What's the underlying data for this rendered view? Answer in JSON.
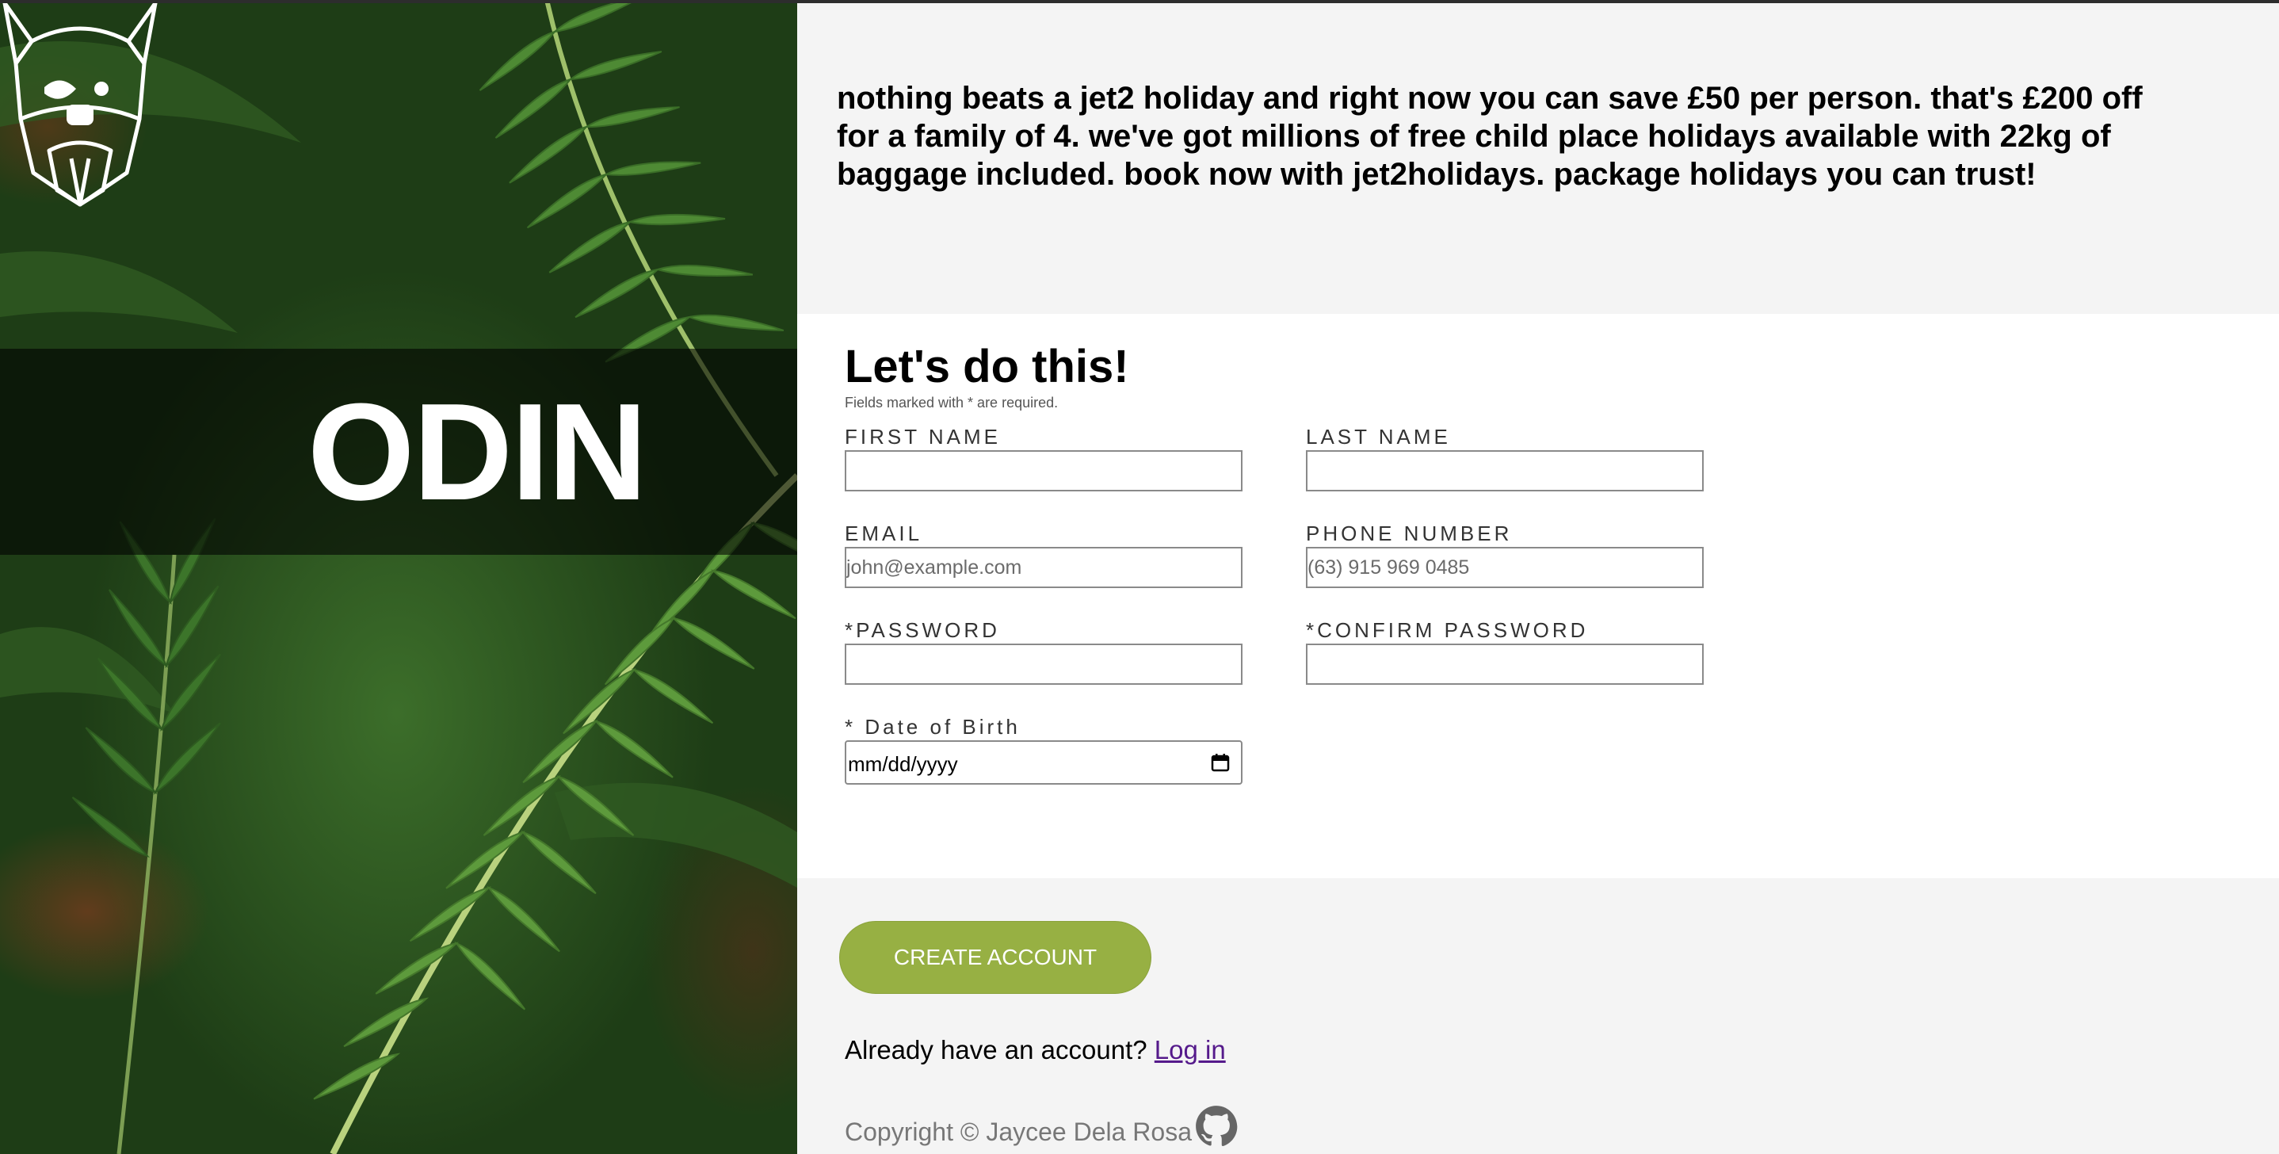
{
  "brand": {
    "logo_text": "ODIN"
  },
  "promo": {
    "text": "nothing beats a jet2 holiday and right now you can save £50 per person. that's £200 off for a family of 4. we've got millions of free child place holidays available with 22kg of baggage included. book now with jet2holidays. package holidays you can trust!"
  },
  "form": {
    "title": "Let's do this!",
    "note": "Fields marked with * are required.",
    "first_name": {
      "label": "FIRST NAME",
      "value": "",
      "placeholder": ""
    },
    "last_name": {
      "label": "LAST NAME",
      "value": "",
      "placeholder": ""
    },
    "email": {
      "label": "EMAIL",
      "value": "",
      "placeholder": "john@example.com"
    },
    "phone": {
      "label": "PHONE NUMBER",
      "value": "",
      "placeholder": "(63) 915 969 0485"
    },
    "password": {
      "label": "*PASSWORD",
      "value": "",
      "placeholder": ""
    },
    "confirm_password": {
      "label": "*CONFIRM PASSWORD",
      "value": "",
      "placeholder": ""
    },
    "dob": {
      "label": "* Date of Birth",
      "placeholder": "mm/dd/yyyy"
    }
  },
  "actions": {
    "create_account_label": "CREATE ACCOUNT",
    "login_prompt": "Already have an account?",
    "login_link": "Log in"
  },
  "footer": {
    "copyright": "Copyright © Jaycee Dela Rosa"
  },
  "colors": {
    "button": "#97b043",
    "link": "#551a8b",
    "panel_bg": "#f4f4f4"
  }
}
